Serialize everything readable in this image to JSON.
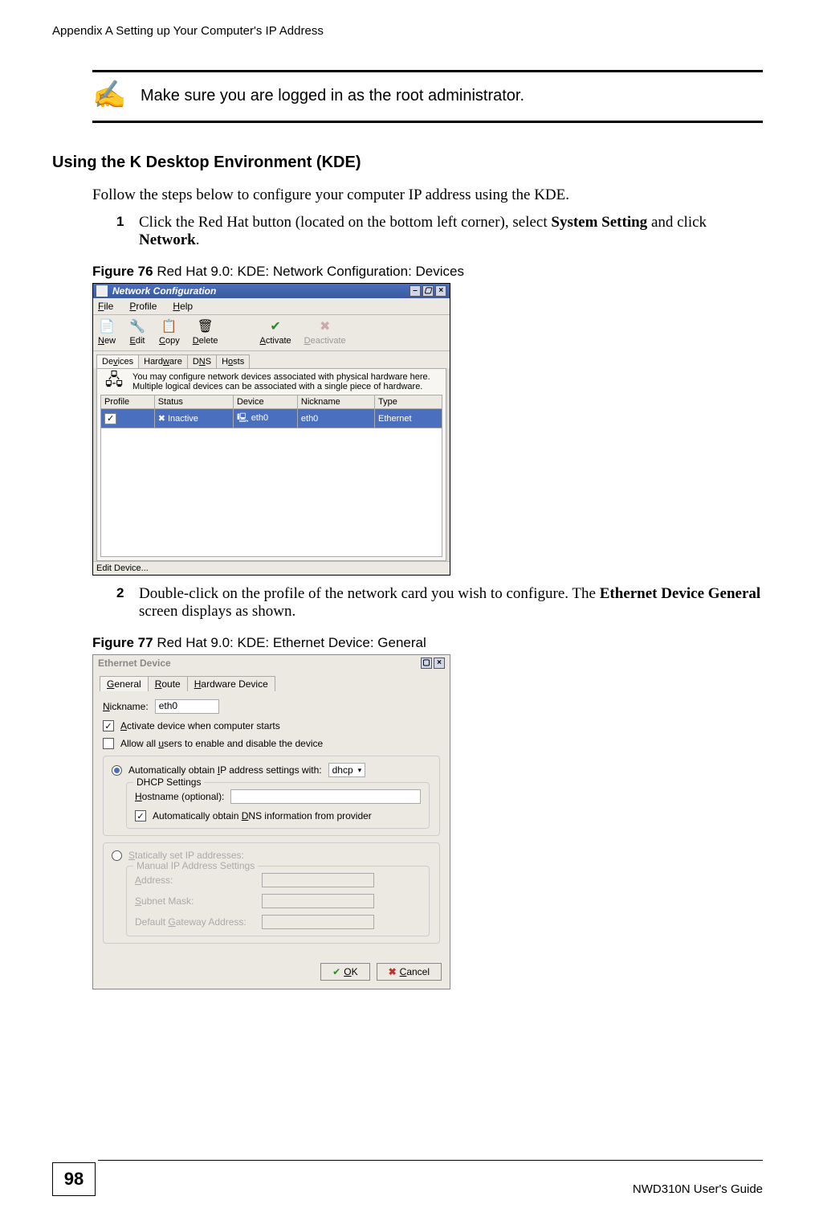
{
  "header": "Appendix A Setting up Your Computer's IP Address",
  "note_text": "Make sure you are logged in as the root administrator.",
  "section_heading": "Using the K Desktop Environment (KDE)",
  "intro_text": "Follow the steps below to configure your computer IP address using the KDE.",
  "step1_num": "1",
  "step1_a": "Click the Red Hat button (located on the bottom left corner), select ",
  "step1_b": "System Setting",
  "step1_c": " and click ",
  "step1_d": "Network",
  "step1_e": ".",
  "fig76_num": "Figure 76",
  "fig76_title": "   Red Hat 9.0: KDE: Network Configuration: Devices",
  "win1": {
    "title": "Network Configuration",
    "menu": {
      "file": "File",
      "file_u": "F",
      "profile": "Profile",
      "profile_u": "P",
      "help": "Help",
      "help_u": "H"
    },
    "toolbar": {
      "new": "New",
      "new_u": "N",
      "edit": "Edit",
      "edit_u": "E",
      "copy": "Copy",
      "copy_u": "C",
      "delete": "Delete",
      "delete_u": "D",
      "activate": "Activate",
      "activate_u": "A",
      "deactivate": "Deactivate",
      "deactivate_u": "D"
    },
    "tabs": {
      "devices": "Devices",
      "devices_u": "v",
      "hardware": "Hardware",
      "hardware_u": "w",
      "dns": "DNS",
      "dns_u": "N",
      "hosts": "Hosts",
      "hosts_u": "o"
    },
    "info": "You may configure network devices associated with physical hardware here. Multiple logical devices can be associated with a single piece of hardware.",
    "cols": {
      "profile": "Profile",
      "status": "Status",
      "device": "Device",
      "nickname": "Nickname",
      "type": "Type"
    },
    "row": {
      "status": "Inactive",
      "device": "eth0",
      "nickname": "eth0",
      "type": "Ethernet",
      "check": "✓"
    },
    "statusbar": "Edit Device..."
  },
  "step2_num": "2",
  "step2_a": "Double-click on the profile of the network card you wish to configure. The ",
  "step2_b": "Ethernet Device General",
  "step2_c": " screen displays as shown.",
  "fig77_num": "Figure 77",
  "fig77_title": "   Red Hat 9.0: KDE: Ethernet Device: General",
  "win2": {
    "title": "Ethernet Device",
    "tabs": {
      "general": "General",
      "general_u": "G",
      "route": "Route",
      "route_u": "R",
      "hwdev": "Hardware Device",
      "hwdev_u": "H"
    },
    "nickname_label": "Nickname:",
    "nickname_label_u": "N",
    "nickname_value": "eth0",
    "activate": "Activate device when computer starts",
    "activate_u": "A",
    "allow": "Allow all users to enable and disable the device",
    "allow_u": "u",
    "auto_ip": "Automatically obtain IP address settings with:",
    "auto_ip_u": "I",
    "dhcp": "dhcp",
    "dhcp_group": "DHCP Settings",
    "hostname": "Hostname (optional):",
    "hostname_u": "H",
    "auto_dns": "Automatically obtain DNS information from provider",
    "auto_dns_u": "D",
    "static": "Statically set IP addresses:",
    "static_u": "S",
    "manual_group": "Manual IP Address Settings",
    "address": "Address:",
    "address_u": "A",
    "subnet": "Subnet Mask:",
    "subnet_u": "S",
    "gateway": "Default Gateway Address:",
    "gateway_u": "G",
    "ok": "OK",
    "ok_u": "O",
    "cancel": "Cancel",
    "cancel_u": "C"
  },
  "page_number": "98",
  "footer_right": "NWD310N User's Guide"
}
